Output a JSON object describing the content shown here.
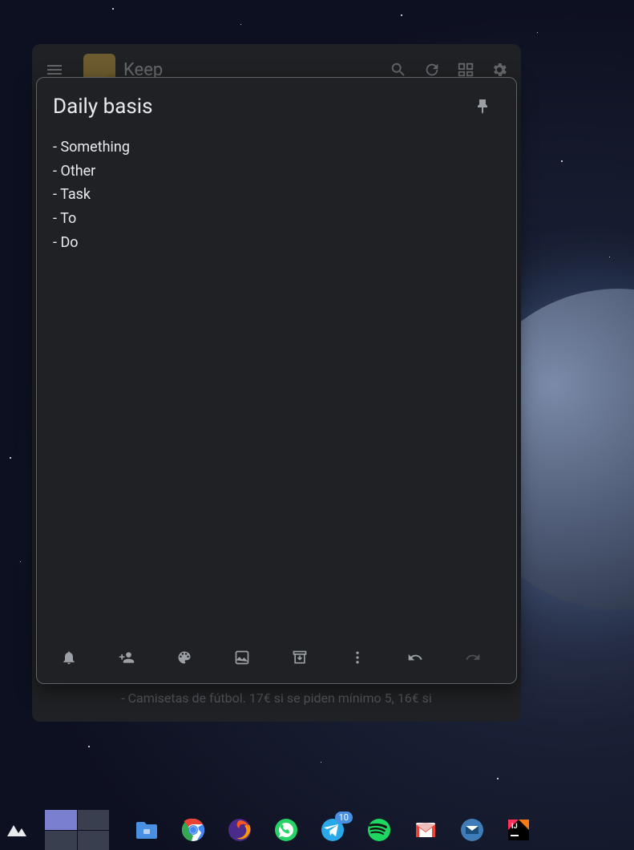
{
  "keep": {
    "app_name": "Keep",
    "bg_note_text": "- Camisetas de fútbol. 17€ si se piden mínimo 5, 16€ si"
  },
  "note": {
    "title": "Daily basis",
    "lines": [
      "- Something",
      "- Other",
      "- Task",
      "- To",
      "- Do"
    ]
  },
  "telegram": {
    "badge": "10"
  }
}
